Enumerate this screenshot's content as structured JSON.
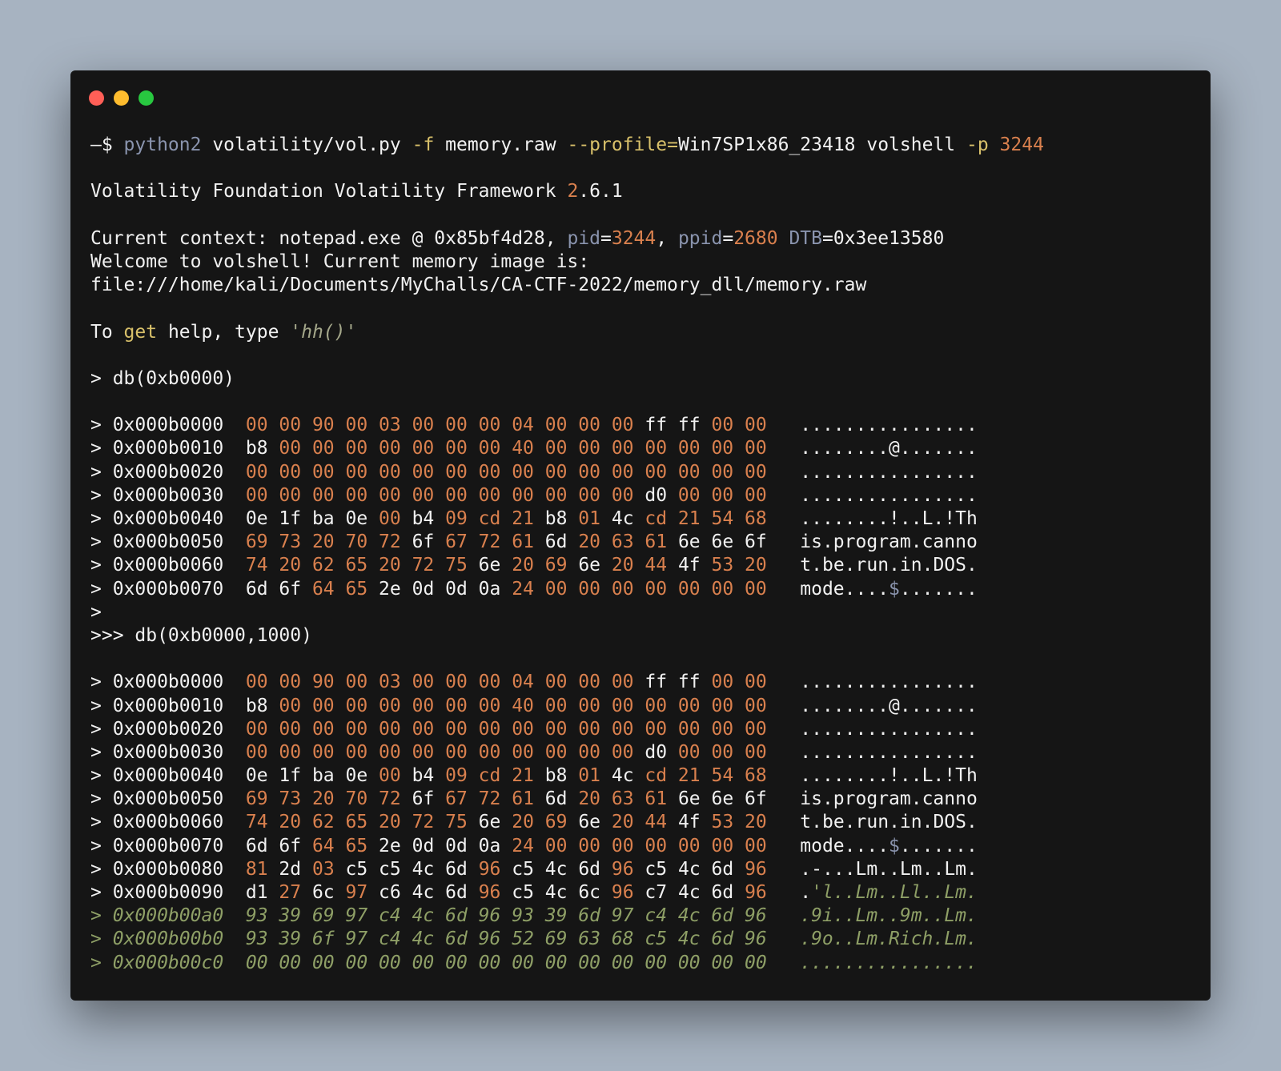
{
  "window": {
    "controls": [
      "close",
      "minimize",
      "maximize"
    ],
    "colors": {
      "background": "#151515",
      "text": "#f1f1f1",
      "orange": "#d9804e",
      "blue_gray": "#8a94ae",
      "yellow": "#d8c06a",
      "dim_green": "#8e9f66"
    }
  },
  "lines": [
    [
      {
        "t": "—$ ",
        "c": ""
      },
      {
        "t": "python2",
        "c": "b"
      },
      {
        "t": " volatility/vol.py ",
        "c": ""
      },
      {
        "t": "-f",
        "c": "y"
      },
      {
        "t": " memory.raw ",
        "c": ""
      },
      {
        "t": "--profile=",
        "c": "y"
      },
      {
        "t": "Win7SP1x86_23418 volshell ",
        "c": ""
      },
      {
        "t": "-p",
        "c": "y"
      },
      {
        "t": " ",
        "c": ""
      },
      {
        "t": "3244",
        "c": "o"
      }
    ],
    [],
    [
      {
        "t": "Volatility Foundation Volatility Framework ",
        "c": ""
      },
      {
        "t": "2",
        "c": "o"
      },
      {
        "t": ".6.1",
        "c": ""
      }
    ],
    [],
    [
      {
        "t": "Current context: notepad.exe @ 0x85bf4d28, ",
        "c": ""
      },
      {
        "t": "pid",
        "c": "b"
      },
      {
        "t": "=",
        "c": ""
      },
      {
        "t": "3244",
        "c": "o"
      },
      {
        "t": ", ",
        "c": ""
      },
      {
        "t": "ppid",
        "c": "b"
      },
      {
        "t": "=",
        "c": ""
      },
      {
        "t": "2680",
        "c": "o"
      },
      {
        "t": " ",
        "c": ""
      },
      {
        "t": "DTB",
        "c": "b"
      },
      {
        "t": "=0x3ee13580",
        "c": ""
      }
    ],
    [
      {
        "t": "Welcome to volshell! Current memory image is:",
        "c": ""
      }
    ],
    [
      {
        "t": "file:///home/kali/Documents/MyChalls/CA-CTF-2022/memory_dll/memory.raw",
        "c": ""
      }
    ],
    [],
    [
      {
        "t": "To ",
        "c": ""
      },
      {
        "t": "get",
        "c": "y"
      },
      {
        "t": " help, type ",
        "c": ""
      },
      {
        "t": "'hh()'",
        "c": "s"
      }
    ],
    [],
    [
      {
        "t": "> db(0xb0000)",
        "c": ""
      }
    ],
    [],
    [
      {
        "t": "> 0x000b0000  ",
        "c": ""
      },
      {
        "t": "00 00 90 00 03 00 00 00 04 00 00 00",
        "c": "o"
      },
      {
        "t": " ff ff ",
        "c": ""
      },
      {
        "t": "00 00",
        "c": "o"
      },
      {
        "t": "   ................",
        "c": ""
      }
    ],
    [
      {
        "t": "> 0x000b0010  b8 ",
        "c": ""
      },
      {
        "t": "00 00 00 00 00 00 00 40 00 00 00 00 00 00 00",
        "c": "o"
      },
      {
        "t": "   ........@.......",
        "c": ""
      }
    ],
    [
      {
        "t": "> 0x000b0020  ",
        "c": ""
      },
      {
        "t": "00 00 00 00 00 00 00 00 00 00 00 00 00 00 00 00",
        "c": "o"
      },
      {
        "t": "   ................",
        "c": ""
      }
    ],
    [
      {
        "t": "> 0x000b0030  ",
        "c": ""
      },
      {
        "t": "00 00 00 00 00 00 00 00 00 00 00 00",
        "c": "o"
      },
      {
        "t": " d0 ",
        "c": ""
      },
      {
        "t": "00 00 00",
        "c": "o"
      },
      {
        "t": "   ................",
        "c": ""
      }
    ],
    [
      {
        "t": "> 0x000b0040  0e 1f ba 0e ",
        "c": ""
      },
      {
        "t": "00",
        "c": "o"
      },
      {
        "t": " b4 ",
        "c": ""
      },
      {
        "t": "09 cd 21",
        "c": "o"
      },
      {
        "t": " b8 ",
        "c": ""
      },
      {
        "t": "01",
        "c": "o"
      },
      {
        "t": " 4c ",
        "c": ""
      },
      {
        "t": "cd 21 54 68",
        "c": "o"
      },
      {
        "t": "   ........!..L.!Th",
        "c": ""
      }
    ],
    [
      {
        "t": "> 0x000b0050  ",
        "c": ""
      },
      {
        "t": "69 73 20 70 72",
        "c": "o"
      },
      {
        "t": " 6f ",
        "c": ""
      },
      {
        "t": "67 72 61",
        "c": "o"
      },
      {
        "t": " 6d ",
        "c": ""
      },
      {
        "t": "20 63 61",
        "c": "o"
      },
      {
        "t": " 6e 6e 6f   is.program.canno",
        "c": ""
      }
    ],
    [
      {
        "t": "> 0x000b0060  ",
        "c": ""
      },
      {
        "t": "74 20 62 65 20 72 75",
        "c": "o"
      },
      {
        "t": " 6e ",
        "c": ""
      },
      {
        "t": "20 69",
        "c": "o"
      },
      {
        "t": " 6e ",
        "c": ""
      },
      {
        "t": "20 44",
        "c": "o"
      },
      {
        "t": " 4f ",
        "c": ""
      },
      {
        "t": "53 20",
        "c": "o"
      },
      {
        "t": "   t.be.run.in.DOS.",
        "c": ""
      }
    ],
    [
      {
        "t": "> 0x000b0070  6d 6f ",
        "c": ""
      },
      {
        "t": "64 65",
        "c": "o"
      },
      {
        "t": " 2e 0d 0d 0a ",
        "c": ""
      },
      {
        "t": "24 00 00 00 00 00 00 00",
        "c": "o"
      },
      {
        "t": "   mode....",
        "c": ""
      },
      {
        "t": "$",
        "c": "b"
      },
      {
        "t": ".......",
        "c": ""
      }
    ],
    [
      {
        "t": ">",
        "c": ""
      }
    ],
    [
      {
        "t": ">>> db(0xb0000,1000)",
        "c": ""
      }
    ],
    [],
    [
      {
        "t": "> 0x000b0000  ",
        "c": ""
      },
      {
        "t": "00 00 90 00 03 00 00 00 04 00 00 00",
        "c": "o"
      },
      {
        "t": " ff ff ",
        "c": ""
      },
      {
        "t": "00 00",
        "c": "o"
      },
      {
        "t": "   ................",
        "c": ""
      }
    ],
    [
      {
        "t": "> 0x000b0010  b8 ",
        "c": ""
      },
      {
        "t": "00 00 00 00 00 00 00 40 00 00 00 00 00 00 00",
        "c": "o"
      },
      {
        "t": "   ........@.......",
        "c": ""
      }
    ],
    [
      {
        "t": "> 0x000b0020  ",
        "c": ""
      },
      {
        "t": "00 00 00 00 00 00 00 00 00 00 00 00 00 00 00 00",
        "c": "o"
      },
      {
        "t": "   ................",
        "c": ""
      }
    ],
    [
      {
        "t": "> 0x000b0030  ",
        "c": ""
      },
      {
        "t": "00 00 00 00 00 00 00 00 00 00 00 00",
        "c": "o"
      },
      {
        "t": " d0 ",
        "c": ""
      },
      {
        "t": "00 00 00",
        "c": "o"
      },
      {
        "t": "   ................",
        "c": ""
      }
    ],
    [
      {
        "t": "> 0x000b0040  0e 1f ba 0e ",
        "c": ""
      },
      {
        "t": "00",
        "c": "o"
      },
      {
        "t": " b4 ",
        "c": ""
      },
      {
        "t": "09 cd 21",
        "c": "o"
      },
      {
        "t": " b8 ",
        "c": ""
      },
      {
        "t": "01",
        "c": "o"
      },
      {
        "t": " 4c ",
        "c": ""
      },
      {
        "t": "cd 21 54 68",
        "c": "o"
      },
      {
        "t": "   ........!..L.!Th",
        "c": ""
      }
    ],
    [
      {
        "t": "> 0x000b0050  ",
        "c": ""
      },
      {
        "t": "69 73 20 70 72",
        "c": "o"
      },
      {
        "t": " 6f ",
        "c": ""
      },
      {
        "t": "67 72 61",
        "c": "o"
      },
      {
        "t": " 6d ",
        "c": ""
      },
      {
        "t": "20 63 61",
        "c": "o"
      },
      {
        "t": " 6e 6e 6f   is.program.canno",
        "c": ""
      }
    ],
    [
      {
        "t": "> 0x000b0060  ",
        "c": ""
      },
      {
        "t": "74 20 62 65 20 72 75",
        "c": "o"
      },
      {
        "t": " 6e ",
        "c": ""
      },
      {
        "t": "20 69",
        "c": "o"
      },
      {
        "t": " 6e ",
        "c": ""
      },
      {
        "t": "20 44",
        "c": "o"
      },
      {
        "t": " 4f ",
        "c": ""
      },
      {
        "t": "53 20",
        "c": "o"
      },
      {
        "t": "   t.be.run.in.DOS.",
        "c": ""
      }
    ],
    [
      {
        "t": "> 0x000b0070  6d 6f ",
        "c": ""
      },
      {
        "t": "64 65",
        "c": "o"
      },
      {
        "t": " 2e 0d 0d 0a ",
        "c": ""
      },
      {
        "t": "24 00 00 00 00 00 00 00",
        "c": "o"
      },
      {
        "t": "   mode....",
        "c": ""
      },
      {
        "t": "$",
        "c": "b"
      },
      {
        "t": ".......",
        "c": ""
      }
    ],
    [
      {
        "t": "> 0x000b0080  ",
        "c": ""
      },
      {
        "t": "81",
        "c": "o"
      },
      {
        "t": " 2d ",
        "c": ""
      },
      {
        "t": "03",
        "c": "o"
      },
      {
        "t": " c5 c5 4c 6d ",
        "c": ""
      },
      {
        "t": "96",
        "c": "o"
      },
      {
        "t": " c5 4c 6d ",
        "c": ""
      },
      {
        "t": "96",
        "c": "o"
      },
      {
        "t": " c5 4c 6d ",
        "c": ""
      },
      {
        "t": "96",
        "c": "o"
      },
      {
        "t": "   .-...Lm..Lm..Lm.",
        "c": ""
      }
    ],
    [
      {
        "t": "> 0x000b0090  d1 ",
        "c": ""
      },
      {
        "t": "27",
        "c": "o"
      },
      {
        "t": " 6c ",
        "c": ""
      },
      {
        "t": "97",
        "c": "o"
      },
      {
        "t": " c6 4c 6d ",
        "c": ""
      },
      {
        "t": "96",
        "c": "o"
      },
      {
        "t": " c5 4c 6c ",
        "c": ""
      },
      {
        "t": "96",
        "c": "o"
      },
      {
        "t": " c7 4c 6d ",
        "c": ""
      },
      {
        "t": "96",
        "c": "o"
      },
      {
        "t": "   .",
        "c": ""
      },
      {
        "t": "'l..Lm..Ll..Lm.",
        "c": "dim"
      }
    ],
    [
      {
        "t": "> 0x000b00a0  93 39 69 97 c4 4c 6d 96 93 39 6d 97 c4 4c 6d 96   .9i..Lm..9m..Lm.",
        "c": "dim"
      }
    ],
    [
      {
        "t": "> 0x000b00b0  93 39 6f 97 c4 4c 6d 96 52 69 63 68 c5 4c 6d 96   .9o..Lm.Rich.Lm.",
        "c": "dim"
      }
    ],
    [
      {
        "t": "> 0x000b00c0  00 00 00 00 00 00 00 00 00 00 00 00 00 00 00 00   ................",
        "c": "dim"
      }
    ]
  ]
}
